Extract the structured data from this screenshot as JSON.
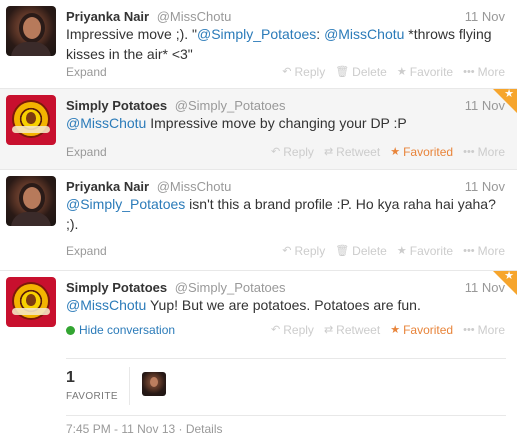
{
  "tweets": [
    {
      "name": "Priyanka Nair",
      "handle": "@MissChotu",
      "time": "11 Nov",
      "text_plain_1": "Impressive move ;). \"",
      "mention_1": "@Simply_Potatoes",
      "text_plain_2": ": ",
      "mention_2": "@MissChotu",
      "text_plain_3": " *throws flying kisses in the air* <3\"",
      "expand_label": "Expand",
      "actions": {
        "reply": "Reply",
        "delete": "Delete",
        "favorite": "Favorite",
        "more": "More"
      }
    },
    {
      "name": "Simply Potatoes",
      "handle": "@Simply_Potatoes",
      "time": "11 Nov",
      "mention_1": "@MissChotu",
      "text_plain_1": " Impressive move by changing your DP :P",
      "expand_label": "Expand",
      "actions": {
        "reply": "Reply",
        "retweet": "Retweet",
        "favorited": "Favorited",
        "more": "More"
      }
    },
    {
      "name": "Priyanka Nair",
      "handle": "@MissChotu",
      "time": "11 Nov",
      "mention_1": "@Simply_Potatoes",
      "text_plain_1": " isn't this a brand profile :P. Ho kya raha hai yaha? ;).",
      "expand_label": "Expand",
      "actions": {
        "reply": "Reply",
        "delete": "Delete",
        "favorite": "Favorite",
        "more": "More"
      }
    },
    {
      "name": "Simply Potatoes",
      "handle": "@Simply_Potatoes",
      "time": "11 Nov",
      "mention_1": "@MissChotu",
      "text_plain_1": " Yup! But we are potatoes. Potatoes are fun.",
      "hide_conversation_label": "Hide conversation",
      "actions": {
        "reply": "Reply",
        "retweet": "Retweet",
        "favorited": "Favorited",
        "more": "More"
      },
      "favorite_count": "1",
      "favorite_label": "FAVORITE",
      "details_line": "7:45 PM - 11 Nov 13 · Details"
    }
  ],
  "colors": {
    "mention": "#2b7bb9",
    "muted": "#999999",
    "favorite": "#e8843a",
    "corner": "#f6a52d",
    "green": "#33a532",
    "brand_red": "#c8102e"
  }
}
